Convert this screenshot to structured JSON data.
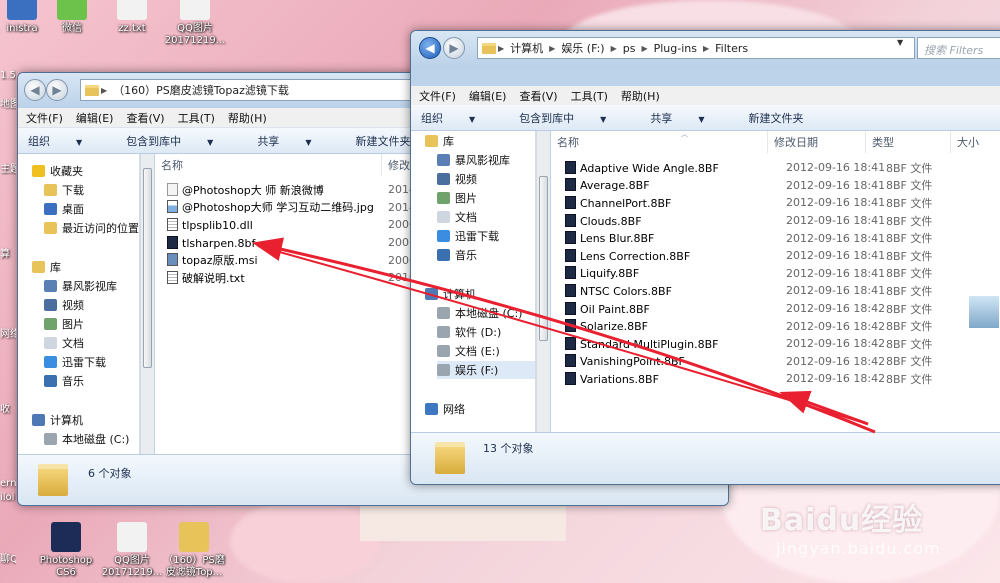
{
  "desktop": {
    "top_icons": [
      "inistra",
      "微信",
      "zz.txt",
      "QQ图片 20171219..."
    ],
    "left_edge_labels": [
      "1.53",
      "地图",
      "主题",
      "算",
      "网络",
      "收",
      "ern",
      "iloi",
      "聊QQ"
    ],
    "bottom_icons": [
      "Photoshop CS6",
      "QQ图片 20171219...",
      "（160）PS磨 皮滤镜Top..."
    ]
  },
  "left_window": {
    "address": [
      "（160）PS磨皮滤镜Topaz滤镜下载"
    ],
    "menu": [
      "文件(F)",
      "编辑(E)",
      "查看(V)",
      "工具(T)",
      "帮助(H)"
    ],
    "toolbar": [
      "组织",
      "包含到库中",
      "共享",
      "新建文件夹"
    ],
    "nav": [
      {
        "label": "收藏夹",
        "icon": "star-icon"
      },
      {
        "label": "下载",
        "icon": "download-folder-icon"
      },
      {
        "label": "桌面",
        "icon": "desktop-icon"
      },
      {
        "label": "最近访问的位置",
        "icon": "recent-places-icon"
      },
      {
        "label": "库",
        "icon": "library-icon"
      },
      {
        "label": "暴风影视库",
        "icon": "video-library-icon"
      },
      {
        "label": "视频",
        "icon": "video-icon"
      },
      {
        "label": "图片",
        "icon": "pictures-icon"
      },
      {
        "label": "文档",
        "icon": "documents-icon"
      },
      {
        "label": "迅雷下载",
        "icon": "thunder-download-icon"
      },
      {
        "label": "音乐",
        "icon": "music-icon"
      },
      {
        "label": "计算机",
        "icon": "computer-icon"
      },
      {
        "label": "本地磁盘 (C:)",
        "icon": "drive-icon"
      }
    ],
    "col_name": "名称",
    "col_date": "修改日",
    "files": [
      {
        "name": "@Photoshop大 师 新浪微博",
        "date": "2014",
        "icon": "web-shortcut-icon"
      },
      {
        "name": "@Photoshop大师 学习互动二维码.jpg",
        "date": "2014",
        "icon": "image-file-icon"
      },
      {
        "name": "tlpsplib10.dll",
        "date": "2006",
        "icon": "dll-file-icon"
      },
      {
        "name": "tlsharpen.8bf",
        "date": "2007",
        "icon": "plugin-file-icon"
      },
      {
        "name": "topaz原版.msi",
        "date": "2006",
        "icon": "msi-file-icon"
      },
      {
        "name": "破解说明.txt",
        "date": "2010",
        "icon": "text-file-icon"
      }
    ],
    "status": "6 个对象"
  },
  "right_window": {
    "address": [
      "计算机",
      "娱乐 (F:)",
      "ps",
      "Plug-ins",
      "Filters"
    ],
    "search_placeholder": "搜索 Filters",
    "menu": [
      "文件(F)",
      "编辑(E)",
      "查看(V)",
      "工具(T)",
      "帮助(H)"
    ],
    "toolbar": [
      "组织",
      "包含到库中",
      "共享",
      "新建文件夹"
    ],
    "nav": [
      {
        "label": "库",
        "icon": "library-icon"
      },
      {
        "label": "暴风影视库",
        "icon": "video-library-icon"
      },
      {
        "label": "视频",
        "icon": "video-icon"
      },
      {
        "label": "图片",
        "icon": "pictures-icon"
      },
      {
        "label": "文档",
        "icon": "documents-icon"
      },
      {
        "label": "迅雷下载",
        "icon": "thunder-download-icon"
      },
      {
        "label": "音乐",
        "icon": "music-icon"
      },
      {
        "label": "计算机",
        "icon": "computer-icon"
      },
      {
        "label": "本地磁盘 (C:)",
        "icon": "drive-icon"
      },
      {
        "label": "软件 (D:)",
        "icon": "drive-icon"
      },
      {
        "label": "文档 (E:)",
        "icon": "drive-icon"
      },
      {
        "label": "娱乐 (F:)",
        "icon": "drive-icon"
      },
      {
        "label": "网络",
        "icon": "network-icon"
      }
    ],
    "columns": [
      "名称",
      "修改日期",
      "类型",
      "大小"
    ],
    "files": [
      {
        "name": "Adaptive Wide Angle.8BF",
        "date": "2012-09-16 18:41",
        "type": "8BF 文件"
      },
      {
        "name": "Average.8BF",
        "date": "2012-09-16 18:41",
        "type": "8BF 文件"
      },
      {
        "name": "ChannelPort.8BF",
        "date": "2012-09-16 18:41",
        "type": "8BF 文件"
      },
      {
        "name": "Clouds.8BF",
        "date": "2012-09-16 18:41",
        "type": "8BF 文件"
      },
      {
        "name": "Lens Blur.8BF",
        "date": "2012-09-16 18:41",
        "type": "8BF 文件"
      },
      {
        "name": "Lens Correction.8BF",
        "date": "2012-09-16 18:41",
        "type": "8BF 文件"
      },
      {
        "name": "Liquify.8BF",
        "date": "2012-09-16 18:41",
        "type": "8BF 文件"
      },
      {
        "name": "NTSC Colors.8BF",
        "date": "2012-09-16 18:41",
        "type": "8BF 文件"
      },
      {
        "name": "Oil Paint.8BF",
        "date": "2012-09-16 18:42",
        "type": "8BF 文件"
      },
      {
        "name": "Solarize.8BF",
        "date": "2012-09-16 18:42",
        "type": "8BF 文件"
      },
      {
        "name": "Standard MultiPlugin.8BF",
        "date": "2012-09-16 18:42",
        "type": "8BF 文件"
      },
      {
        "name": "VanishingPoint.8BF",
        "date": "2012-09-16 18:42",
        "type": "8BF 文件"
      },
      {
        "name": "Variations.8BF",
        "date": "2012-09-16 18:42",
        "type": "8BF 文件"
      }
    ],
    "status": "13 个对象"
  },
  "watermark": {
    "logo": "Baidu经验",
    "url": "jingyan.baidu.com"
  },
  "colors": {
    "annotation_arrow": "#e8202f",
    "plugin_icon": "#1e2a44"
  }
}
